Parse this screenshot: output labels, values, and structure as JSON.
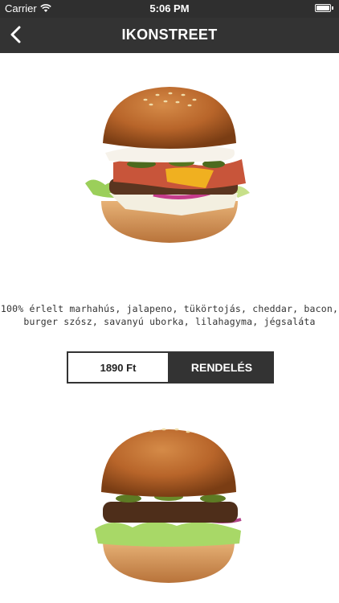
{
  "status_bar": {
    "carrier": "Carrier",
    "time": "5:06 PM",
    "battery_level": 1.0
  },
  "nav": {
    "title": "IKONSTREET"
  },
  "items": [
    {
      "description": "100% érlelt marhahús, jalapeno, tükörtojás, cheddar, bacon, burger szósz, savanyú uborka, lilahagyma, jégsaláta",
      "price": "1890 Ft",
      "order_label": "RENDELÉS"
    }
  ]
}
